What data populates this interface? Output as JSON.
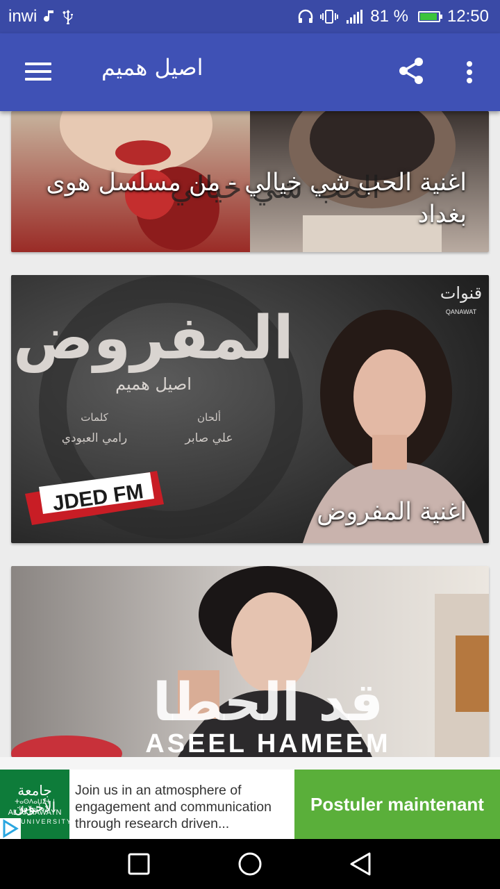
{
  "status_bar": {
    "carrier": "inwi",
    "signal_percent": "81 %",
    "time": "12:50",
    "icons": [
      "music-note-icon",
      "usb-icon",
      "headphones-icon",
      "vibrate-icon",
      "signal-icon",
      "battery-charging-icon"
    ]
  },
  "app_bar": {
    "title": "اصيل هميم",
    "menu_icon": "hamburger-menu-icon",
    "share_icon": "share-icon",
    "more_icon": "more-vert-icon"
  },
  "songs": [
    {
      "title": "اغنية الحب شي خيالي - من مسلسل هوى بغداد",
      "thumbnail_text": "الحب شي خيالي"
    },
    {
      "title": "اغنية المفروض",
      "thumbnail_text": "المفروض",
      "thumbnail_sub": "اصيل هميم",
      "credit_composer_label": "ألحان",
      "credit_composer": "علي صابر",
      "credit_lyrics_label": "كلمات",
      "credit_lyrics": "رامي العبودي",
      "radio_badge": "JDED FM",
      "channel_logo": "قنوات",
      "channel_logo_latin": "QANAWAT"
    },
    {
      "title": "",
      "thumbnail_text": "قد الحطا",
      "thumbnail_sub": "ASEEL HAMEEM"
    }
  ],
  "ad": {
    "logo_line1": "جامعة الأخوين",
    "logo_line2": "ⵜⴰⵙⴷⴰⵡⵉⵜ ⵏ ⵍⴰⵅⴰⵡⴰⵢⵏ",
    "logo_line3": "AL AKHAWAYN",
    "logo_line4": "UNIVERSITY",
    "text": "Join us in an atmosphere of engagement and communication through research driven...",
    "cta": "Postuler maintenant"
  },
  "nav_bar": {
    "recents_icon": "square-recents-icon",
    "home_icon": "circle-home-icon",
    "back_icon": "triangle-back-icon"
  }
}
